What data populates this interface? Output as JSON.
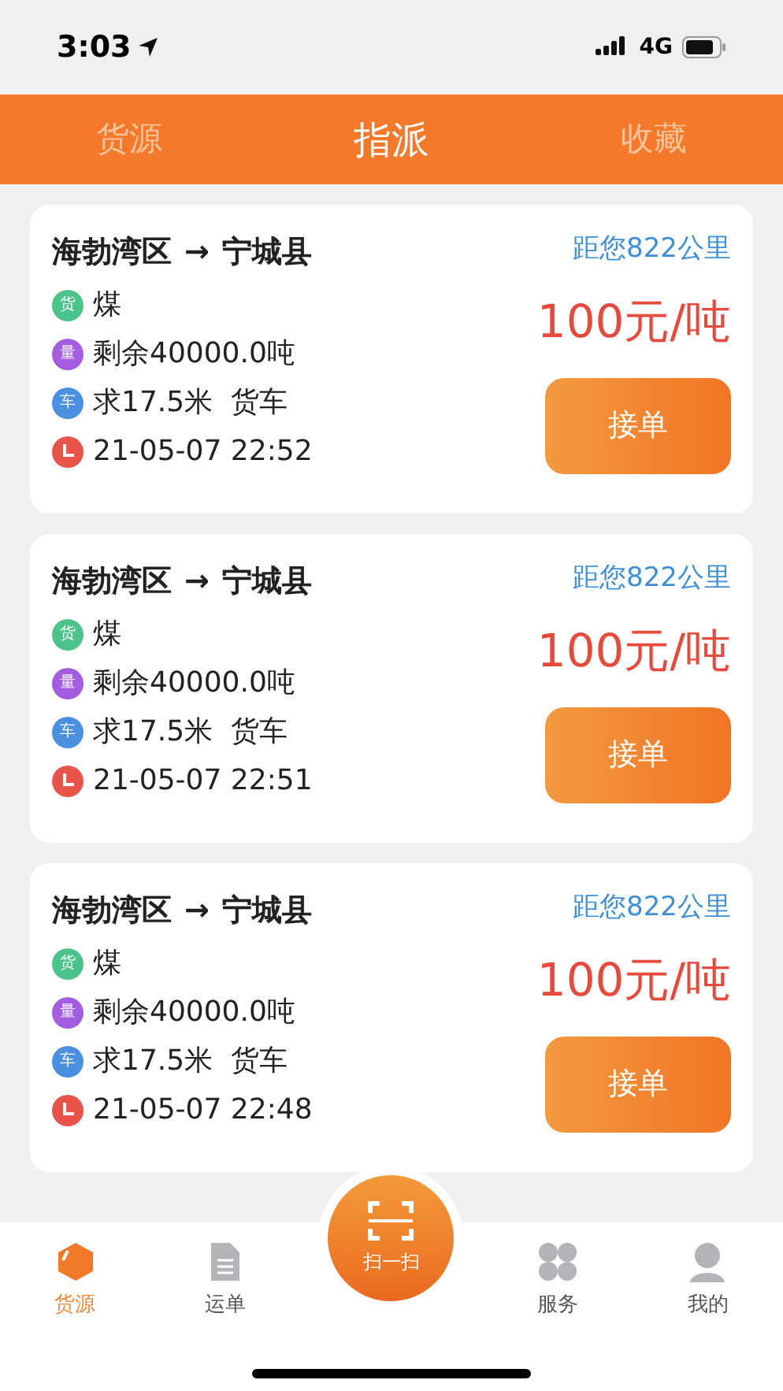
{
  "status_bar": {
    "time": "3:03",
    "network": "4G"
  },
  "tabs": [
    {
      "label": "货源",
      "selected": false
    },
    {
      "label": "指派",
      "selected": true
    },
    {
      "label": "收藏",
      "selected": false
    }
  ],
  "cards": [
    {
      "route_from": "海勃湾区",
      "route_arrow": "→",
      "route_to": "宁城县",
      "distance": "距您822公里",
      "price": "100元/吨",
      "button": "接单",
      "lines": [
        {
          "kind": "badge",
          "badge": "货",
          "color": "#4cc38a",
          "text": "煤"
        },
        {
          "kind": "badge",
          "badge": "量",
          "color": "#a45de0",
          "text": "剩余40000.0吨"
        },
        {
          "kind": "badge",
          "badge": "车",
          "color": "#4a8fe0",
          "text": "求17.5米  货车"
        },
        {
          "kind": "clock",
          "color": "#e8534a",
          "text": "21-05-07 22:52"
        }
      ]
    },
    {
      "route_from": "海勃湾区",
      "route_arrow": "→",
      "route_to": "宁城县",
      "distance": "距您822公里",
      "price": "100元/吨",
      "button": "接单",
      "lines": [
        {
          "kind": "badge",
          "badge": "货",
          "color": "#4cc38a",
          "text": "煤"
        },
        {
          "kind": "badge",
          "badge": "量",
          "color": "#a45de0",
          "text": "剩余40000.0吨"
        },
        {
          "kind": "badge",
          "badge": "车",
          "color": "#4a8fe0",
          "text": "求17.5米  货车"
        },
        {
          "kind": "clock",
          "color": "#e8534a",
          "text": "21-05-07 22:51"
        }
      ]
    },
    {
      "route_from": "海勃湾区",
      "route_arrow": "→",
      "route_to": "宁城县",
      "distance": "距您822公里",
      "price": "100元/吨",
      "button": "接单",
      "lines": [
        {
          "kind": "badge",
          "badge": "货",
          "color": "#4cc38a",
          "text": "煤"
        },
        {
          "kind": "badge",
          "badge": "量",
          "color": "#a45de0",
          "text": "剩余40000.0吨"
        },
        {
          "kind": "badge",
          "badge": "车",
          "color": "#4a8fe0",
          "text": "求17.5米  货车"
        },
        {
          "kind": "clock",
          "color": "#e8534a",
          "text": "21-05-07 22:48"
        }
      ]
    }
  ],
  "bottom_nav": [
    {
      "kind": "box",
      "label": "货源",
      "selected": true
    },
    {
      "kind": "document",
      "label": "运单",
      "selected": false
    },
    {
      "kind": "scan",
      "label": "扫一扫",
      "selected": false
    },
    {
      "kind": "grid",
      "label": "服务",
      "selected": false
    },
    {
      "kind": "person",
      "label": "我的",
      "selected": false
    }
  ]
}
